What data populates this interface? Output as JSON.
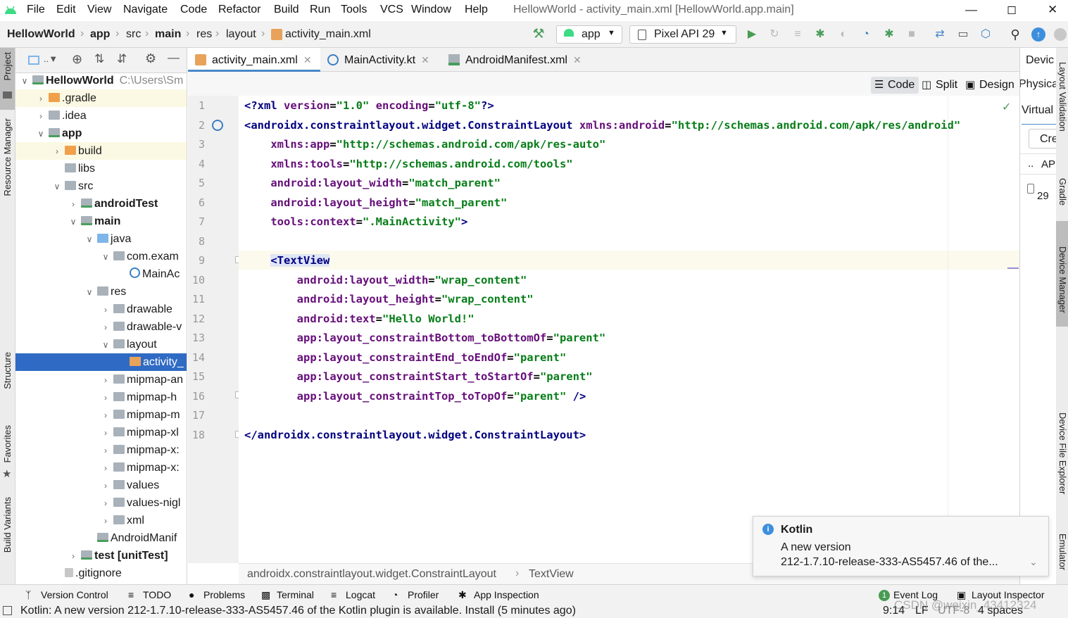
{
  "menu": {
    "items": [
      "File",
      "Edit",
      "View",
      "Navigate",
      "Code",
      "Refactor",
      "Build",
      "Run",
      "Tools",
      "VCS",
      "Window",
      "Help"
    ],
    "window_title": "HellowWorld - activity_main.xml [HellowWorld.app.main]"
  },
  "navbar": {
    "crumbs": [
      "HellowWorld",
      "app",
      "src",
      "main",
      "res",
      "layout",
      "activity_main.xml"
    ],
    "run_config": "app",
    "device": "Pixel API 29"
  },
  "left_strip": {
    "project": "Project",
    "resource_manager": "Resource Manager",
    "structure": "Structure",
    "favorites": "Favorites",
    "build_variants": "Build Variants"
  },
  "project_tree": [
    {
      "label": "HellowWorld",
      "extra": "C:\\Users\\Sm",
      "indent": 0,
      "chev": "v",
      "icon": "mod",
      "bold": true
    },
    {
      "label": ".gradle",
      "indent": 1,
      "chev": ">",
      "icon": "orange",
      "hl": true
    },
    {
      "label": ".idea",
      "indent": 1,
      "chev": ">",
      "icon": "gray"
    },
    {
      "label": "app",
      "indent": 1,
      "chev": "v",
      "icon": "mod",
      "bold": true
    },
    {
      "label": "build",
      "indent": 2,
      "chev": ">",
      "icon": "orange",
      "hl": true
    },
    {
      "label": "libs",
      "indent": 2,
      "chev": "",
      "icon": "gray"
    },
    {
      "label": "src",
      "indent": 2,
      "chev": "v",
      "icon": "gray"
    },
    {
      "label": "androidTest",
      "indent": 3,
      "chev": ">",
      "icon": "mod",
      "bold": true
    },
    {
      "label": "main",
      "indent": 3,
      "chev": "v",
      "icon": "mod",
      "bold": true
    },
    {
      "label": "java",
      "indent": 4,
      "chev": "v",
      "icon": "blue"
    },
    {
      "label": "com.exam",
      "indent": 5,
      "chev": "v",
      "icon": "gray"
    },
    {
      "label": "MainAc",
      "indent": 6,
      "chev": "",
      "icon": "kt"
    },
    {
      "label": "res",
      "indent": 4,
      "chev": "v",
      "icon": "gray"
    },
    {
      "label": "drawable",
      "indent": 5,
      "chev": ">",
      "icon": "gray"
    },
    {
      "label": "drawable-v",
      "indent": 5,
      "chev": ">",
      "icon": "gray"
    },
    {
      "label": "layout",
      "indent": 5,
      "chev": "v",
      "icon": "gray"
    },
    {
      "label": "activity_",
      "indent": 6,
      "chev": "",
      "icon": "xml",
      "sel": true
    },
    {
      "label": "mipmap-an",
      "indent": 5,
      "chev": ">",
      "icon": "gray"
    },
    {
      "label": "mipmap-h",
      "indent": 5,
      "chev": ">",
      "icon": "gray"
    },
    {
      "label": "mipmap-m",
      "indent": 5,
      "chev": ">",
      "icon": "gray"
    },
    {
      "label": "mipmap-xl",
      "indent": 5,
      "chev": ">",
      "icon": "gray"
    },
    {
      "label": "mipmap-x:",
      "indent": 5,
      "chev": ">",
      "icon": "gray"
    },
    {
      "label": "mipmap-x:",
      "indent": 5,
      "chev": ">",
      "icon": "gray"
    },
    {
      "label": "values",
      "indent": 5,
      "chev": ">",
      "icon": "gray"
    },
    {
      "label": "values-nigl",
      "indent": 5,
      "chev": ">",
      "icon": "gray"
    },
    {
      "label": "xml",
      "indent": 5,
      "chev": ">",
      "icon": "gray"
    },
    {
      "label": "AndroidManif",
      "indent": 4,
      "chev": "",
      "icon": "mf"
    },
    {
      "label": "test [unitTest]",
      "indent": 3,
      "chev": ">",
      "icon": "mod",
      "bold": true
    },
    {
      "label": ".gitignore",
      "indent": 2,
      "chev": "",
      "icon": "git"
    }
  ],
  "editor_tabs": [
    {
      "label": "activity_main.xml",
      "active": true,
      "icon": "xml"
    },
    {
      "label": "MainActivity.kt",
      "active": false,
      "icon": "kt"
    },
    {
      "label": "AndroidManifest.xml",
      "active": false,
      "icon": "mf"
    }
  ],
  "view_modes": [
    "Code",
    "Split",
    "Design"
  ],
  "code": {
    "line_numbers": [
      "1",
      "2",
      "3",
      "4",
      "5",
      "6",
      "7",
      "8",
      "9",
      "10",
      "11",
      "12",
      "13",
      "14",
      "15",
      "16",
      "17",
      "18"
    ],
    "lines": [
      [
        [
          "t-tag",
          "<?xml "
        ],
        [
          "t-ns",
          "version"
        ],
        [
          "t-plain",
          "="
        ],
        [
          "t-val",
          "\"1.0\""
        ],
        [
          "t-plain",
          " "
        ],
        [
          "t-ns",
          "encoding"
        ],
        [
          "t-plain",
          "="
        ],
        [
          "t-val",
          "\"utf-8\""
        ],
        [
          "t-tag",
          "?>"
        ]
      ],
      [
        [
          "t-tag",
          "<androidx.constraintlayout.widget.ConstraintLayout "
        ],
        [
          "t-ns",
          "xmlns:"
        ],
        [
          "t-attr",
          "android"
        ],
        [
          "t-plain",
          "="
        ],
        [
          "t-val",
          "\"http://schemas.android.com/apk/res/android\""
        ]
      ],
      [
        [
          "t-plain",
          "    "
        ],
        [
          "t-ns",
          "xmlns:"
        ],
        [
          "t-attr",
          "app"
        ],
        [
          "t-plain",
          "="
        ],
        [
          "t-val",
          "\"http://schemas.android.com/apk/res-auto\""
        ]
      ],
      [
        [
          "t-plain",
          "    "
        ],
        [
          "t-ns",
          "xmlns:"
        ],
        [
          "t-attr",
          "tools"
        ],
        [
          "t-plain",
          "="
        ],
        [
          "t-val",
          "\"http://schemas.android.com/tools\""
        ]
      ],
      [
        [
          "t-plain",
          "    "
        ],
        [
          "t-ns",
          "android:"
        ],
        [
          "t-attr",
          "layout_width"
        ],
        [
          "t-plain",
          "="
        ],
        [
          "t-val",
          "\"match_parent\""
        ]
      ],
      [
        [
          "t-plain",
          "    "
        ],
        [
          "t-ns",
          "android:"
        ],
        [
          "t-attr",
          "layout_height"
        ],
        [
          "t-plain",
          "="
        ],
        [
          "t-val",
          "\"match_parent\""
        ]
      ],
      [
        [
          "t-plain",
          "    "
        ],
        [
          "t-ns",
          "tools:"
        ],
        [
          "t-attr",
          "context"
        ],
        [
          "t-plain",
          "="
        ],
        [
          "t-val",
          "\".MainActivity\""
        ],
        [
          "t-tag",
          ">"
        ]
      ],
      [],
      [
        [
          "t-plain",
          "    "
        ],
        [
          "t-tag",
          "<TextView"
        ]
      ],
      [
        [
          "t-plain",
          "        "
        ],
        [
          "t-ns",
          "android:"
        ],
        [
          "t-attr",
          "layout_width"
        ],
        [
          "t-plain",
          "="
        ],
        [
          "t-val",
          "\"wrap_content\""
        ]
      ],
      [
        [
          "t-plain",
          "        "
        ],
        [
          "t-ns",
          "android:"
        ],
        [
          "t-attr",
          "layout_height"
        ],
        [
          "t-plain",
          "="
        ],
        [
          "t-val",
          "\"wrap_content\""
        ]
      ],
      [
        [
          "t-plain",
          "        "
        ],
        [
          "t-ns",
          "android:"
        ],
        [
          "t-attr",
          "text"
        ],
        [
          "t-plain",
          "="
        ],
        [
          "t-val",
          "\"Hello World!\""
        ]
      ],
      [
        [
          "t-plain",
          "        "
        ],
        [
          "t-ns",
          "app:"
        ],
        [
          "t-attr",
          "layout_constraintBottom_toBottomOf"
        ],
        [
          "t-plain",
          "="
        ],
        [
          "t-val",
          "\"parent\""
        ]
      ],
      [
        [
          "t-plain",
          "        "
        ],
        [
          "t-ns",
          "app:"
        ],
        [
          "t-attr",
          "layout_constraintEnd_toEndOf"
        ],
        [
          "t-plain",
          "="
        ],
        [
          "t-val",
          "\"parent\""
        ]
      ],
      [
        [
          "t-plain",
          "        "
        ],
        [
          "t-ns",
          "app:"
        ],
        [
          "t-attr",
          "layout_constraintStart_toStartOf"
        ],
        [
          "t-plain",
          "="
        ],
        [
          "t-val",
          "\"parent\""
        ]
      ],
      [
        [
          "t-plain",
          "        "
        ],
        [
          "t-ns",
          "app:"
        ],
        [
          "t-attr",
          "layout_constraintTop_toTopOf"
        ],
        [
          "t-plain",
          "="
        ],
        [
          "t-val",
          "\"parent\""
        ],
        [
          "t-tag",
          " />"
        ]
      ],
      [],
      [
        [
          "t-tag",
          "</androidx.constraintlayout.widget.ConstraintLayout>"
        ]
      ]
    ]
  },
  "breadcrumb": [
    "androidx.constraintlayout.widget.ConstraintLayout",
    "TextView"
  ],
  "right_panel": {
    "device": "Devic",
    "physical": "Physica",
    "virtual": "Virtual",
    "create": "Cre",
    "dots": "..",
    "api": "AP",
    "api_value": "29"
  },
  "right_strip": {
    "layout_validation": "Layout Validation",
    "gradle": "Gradle",
    "device_manager": "Device Manager",
    "device_file_explorer": "Device File Explorer",
    "emulator": "Emulator"
  },
  "notification": {
    "title": "Kotlin",
    "line1": "A new version",
    "line2": "212-1.7.10-release-333-AS5457.46 of the..."
  },
  "bottom_tools": [
    "Version Control",
    "TODO",
    "Problems",
    "Terminal",
    "Logcat",
    "Profiler",
    "App Inspection",
    "Event Log",
    "Layout Inspector"
  ],
  "status": {
    "message": "Kotlin: A new version 212-1.7.10-release-333-AS5457.46 of the Kotlin plugin is available. Install (5 minutes ago)",
    "position": "9:14",
    "line_sep": "LF",
    "encoding": "UTF-8",
    "indent": "4 spaces",
    "watermark": "CSDN @weixin_43412324"
  },
  "colors": {
    "accent": "#2f6bc4",
    "run_green": "#499c54",
    "bug_green": "#4a9d5c"
  }
}
